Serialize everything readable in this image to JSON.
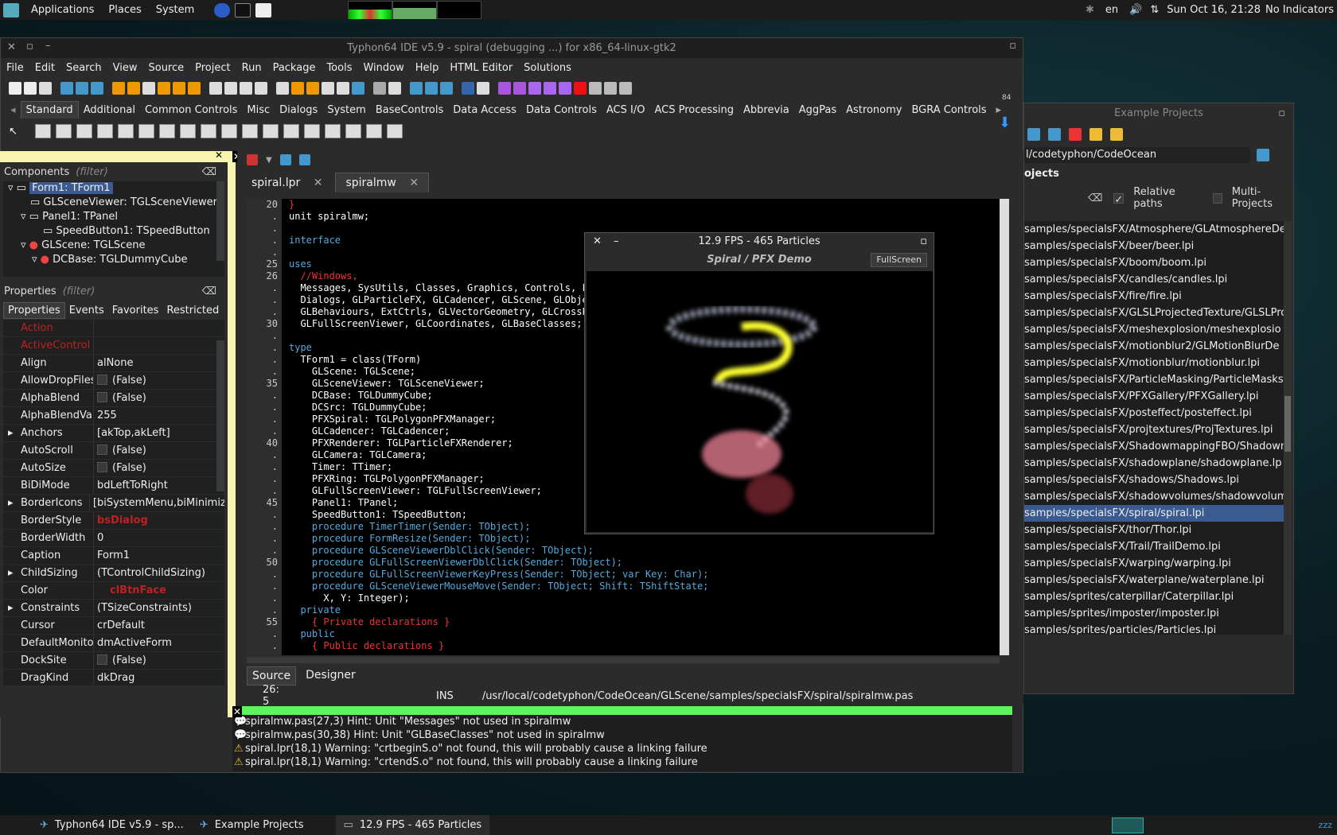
{
  "top_panel": {
    "menus": [
      "Applications",
      "Places",
      "System"
    ],
    "lang": "en",
    "clock": "Sun Oct 16, 21:28",
    "indicators": "No Indicators"
  },
  "ide": {
    "title": "Typhon64 IDE v5.9 - spiral (debugging ...) for x86_64-linux-gtk2",
    "menu": [
      "File",
      "Edit",
      "Search",
      "View",
      "Source",
      "Project",
      "Run",
      "Package",
      "Tools",
      "Window",
      "Help",
      "HTML Editor",
      "Solutions"
    ],
    "palette_tabs": [
      "Standard",
      "Additional",
      "Common Controls",
      "Misc",
      "Dialogs",
      "System",
      "BaseControls",
      "Data Access",
      "Data Controls",
      "ACS I/O",
      "ACS Processing",
      "Abbrevia",
      "AggPas",
      "Astronomy",
      "BGRA Controls"
    ],
    "palette_counter": "84"
  },
  "inspector": {
    "components_label": "Components",
    "filter": "(filter)",
    "tree": [
      "Form1: TForm1",
      "GLSceneViewer: TGLSceneViewer",
      "Panel1: TPanel",
      "SpeedButton1: TSpeedButton",
      "GLScene: TGLScene",
      "DCBase: TGLDummyCube"
    ],
    "properties_label": "Properties",
    "tabs": [
      "Properties",
      "Events",
      "Favorites",
      "Restricted"
    ],
    "props": [
      {
        "n": "Action",
        "v": ""
      },
      {
        "n": "ActiveControl",
        "v": ""
      },
      {
        "n": "Align",
        "v": "alNone"
      },
      {
        "n": "AllowDropFiles",
        "v": "(False)"
      },
      {
        "n": "AlphaBlend",
        "v": "(False)"
      },
      {
        "n": "AlphaBlendValue",
        "v": "255"
      },
      {
        "n": "Anchors",
        "v": "[akTop,akLeft]"
      },
      {
        "n": "AutoScroll",
        "v": "(False)"
      },
      {
        "n": "AutoSize",
        "v": "(False)"
      },
      {
        "n": "BiDiMode",
        "v": "bdLeftToRight"
      },
      {
        "n": "BorderIcons",
        "v": "[biSystemMenu,biMinimize"
      },
      {
        "n": "BorderStyle",
        "v": "bsDialog"
      },
      {
        "n": "BorderWidth",
        "v": "0"
      },
      {
        "n": "Caption",
        "v": "Form1"
      },
      {
        "n": "ChildSizing",
        "v": "(TControlChildSizing)"
      },
      {
        "n": "Color",
        "v": "clBtnFace"
      },
      {
        "n": "Constraints",
        "v": "(TSizeConstraints)"
      },
      {
        "n": "Cursor",
        "v": "crDefault"
      },
      {
        "n": "DefaultMonitor",
        "v": "dmActiveForm"
      },
      {
        "n": "DockSite",
        "v": "(False)"
      },
      {
        "n": "DragKind",
        "v": "dkDrag"
      }
    ]
  },
  "editor": {
    "tabs": [
      "spiral.lpr",
      "spiralmw"
    ],
    "lines": [
      {
        "n": "20",
        "t": "}"
      },
      {
        "n": ".",
        "t": "unit spiralmw;"
      },
      {
        "n": ".",
        "t": ""
      },
      {
        "n": ".",
        "t": "interface"
      },
      {
        "n": ".",
        "t": ""
      },
      {
        "n": "25",
        "t": "uses"
      },
      {
        "n": "26",
        "t": "  //Windows,"
      },
      {
        "n": ".",
        "t": "  Messages, SysUtils, Classes, Graphics, Controls, Fo"
      },
      {
        "n": ".",
        "t": "  Dialogs, GLParticleFX, GLCadencer, GLScene, GLObject"
      },
      {
        "n": ".",
        "t": "  GLBehaviours, ExtCtrls, GLVectorGeometry, GLCrossPl"
      },
      {
        "n": "30",
        "t": "  GLFullScreenViewer, GLCoordinates, GLBaseClasses;"
      },
      {
        "n": ".",
        "t": ""
      },
      {
        "n": ".",
        "t": "type"
      },
      {
        "n": ".",
        "t": "  TForm1 = class(TForm)"
      },
      {
        "n": ".",
        "t": "    GLScene: TGLScene;"
      },
      {
        "n": "35",
        "t": "    GLSceneViewer: TGLSceneViewer;"
      },
      {
        "n": ".",
        "t": "    DCBase: TGLDummyCube;"
      },
      {
        "n": ".",
        "t": "    DCSrc: TGLDummyCube;"
      },
      {
        "n": ".",
        "t": "    PFXSpiral: TGLPolygonPFXManager;"
      },
      {
        "n": ".",
        "t": "    GLCadencer: TGLCadencer;"
      },
      {
        "n": "40",
        "t": "    PFXRenderer: TGLParticleFXRenderer;"
      },
      {
        "n": ".",
        "t": "    GLCamera: TGLCamera;"
      },
      {
        "n": ".",
        "t": "    Timer: TTimer;"
      },
      {
        "n": ".",
        "t": "    PFXRing: TGLPolygonPFXManager;"
      },
      {
        "n": ".",
        "t": "    GLFullScreenViewer: TGLFullScreenViewer;"
      },
      {
        "n": "45",
        "t": "    Panel1: TPanel;"
      },
      {
        "n": ".",
        "t": "    SpeedButton1: TSpeedButton;"
      },
      {
        "n": ".",
        "t": "    procedure TimerTimer(Sender: TObject);"
      },
      {
        "n": ".",
        "t": "    procedure FormResize(Sender: TObject);"
      },
      {
        "n": ".",
        "t": "    procedure GLSceneViewerDblClick(Sender: TObject);"
      },
      {
        "n": "50",
        "t": "    procedure GLFullScreenViewerDblClick(Sender: TObject);"
      },
      {
        "n": ".",
        "t": "    procedure GLFullScreenViewerKeyPress(Sender: TObject; var Key: Char);"
      },
      {
        "n": ".",
        "t": "    procedure GLSceneViewerMouseMove(Sender: TObject; Shift: TShiftState;"
      },
      {
        "n": ".",
        "t": "      X, Y: Integer);"
      },
      {
        "n": ".",
        "t": "  private"
      },
      {
        "n": "55",
        "t": "    { Private declarations }"
      },
      {
        "n": ".",
        "t": "  public"
      },
      {
        "n": ".",
        "t": "    { Public declarations }"
      }
    ],
    "bottom_tabs": [
      "Source",
      "Designer"
    ],
    "status": {
      "pos": "26: 5",
      "mode": "INS",
      "path": "/usr/local/codetyphon/CodeOcean/GLScene/samples/specialsFX/spiral/spiralmw.pas"
    }
  },
  "messages": [
    {
      "icon": "hint",
      "t": "spiralmw.pas(27,3) Hint: Unit \"Messages\" not used in spiralmw"
    },
    {
      "icon": "hint",
      "t": "spiralmw.pas(30,38) Hint: Unit \"GLBaseClasses\" not used in spiralmw"
    },
    {
      "icon": "warn",
      "t": "spiral.lpr(18,1) Warning: \"crtbeginS.o\" not found, this will probably cause a linking failure"
    },
    {
      "icon": "warn",
      "t": "spiral.lpr(18,1) Warning: \"crtendS.o\" not found, this will probably cause a linking failure"
    }
  ],
  "example": {
    "title": "Example Projects",
    "path": "l/codetyphon/CodeOcean",
    "heading": "ojects",
    "relative": "Relative paths",
    "multi": "Multi-Projects",
    "items": [
      "samples/specialsFX/Atmosphere/GLAtmosphereDe",
      "samples/specialsFX/beer/beer.lpi",
      "samples/specialsFX/boom/boom.lpi",
      "samples/specialsFX/candles/candles.lpi",
      "samples/specialsFX/fire/fire.lpi",
      "samples/specialsFX/GLSLProjectedTexture/GLSLPro",
      "samples/specialsFX/meshexplosion/meshexplosio",
      "samples/specialsFX/motionblur2/GLMotionBlurDe",
      "samples/specialsFX/motionblur/motionblur.lpi",
      "samples/specialsFX/ParticleMasking/ParticleMasks",
      "samples/specialsFX/PFXGallery/PFXGallery.lpi",
      "samples/specialsFX/posteffect/posteffect.lpi",
      "samples/specialsFX/projtextures/ProjTextures.lpi",
      "samples/specialsFX/ShadowmappingFBO/Shadowm",
      "samples/specialsFX/shadowplane/shadowplane.lp",
      "samples/specialsFX/shadows/Shadows.lpi",
      "samples/specialsFX/shadowvolumes/shadowvolum",
      "samples/specialsFX/spiral/spiral.lpi",
      "samples/specialsFX/thor/Thor.lpi",
      "samples/specialsFX/Trail/TrailDemo.lpi",
      "samples/specialsFX/warping/warping.lpi",
      "samples/specialsFX/waterplane/waterplane.lpi",
      "samples/sprites/caterpillar/Caterpillar.lpi",
      "samples/sprites/imposter/imposter.lpi",
      "samples/sprites/particles/Particles.lpi"
    ],
    "selected": 17
  },
  "spiral": {
    "title": "12.9 FPS - 465 Particles",
    "heading": "Spiral / PFX Demo",
    "fullscreen": "FullScreen"
  },
  "taskbar": [
    "Typhon64 IDE v5.9 - sp...",
    "Example Projects",
    "12.9 FPS - 465 Particles"
  ],
  "colors": {
    "accent": "#3a5a90",
    "green": "#5ef55e",
    "error": "#c02020"
  }
}
